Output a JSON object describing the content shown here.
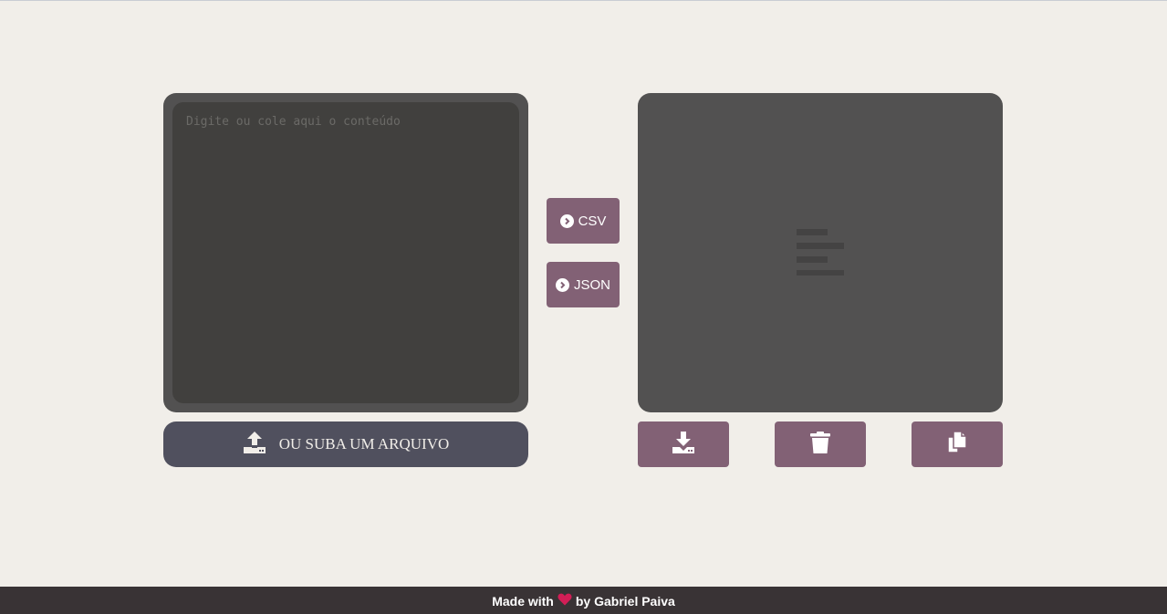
{
  "editor": {
    "placeholder": "Digite ou cole aqui o conteúdo",
    "value": ""
  },
  "upload": {
    "label": "OU SUBA UM ARQUIVO",
    "icon": "upload-icon"
  },
  "convert": {
    "csv_label": "CSV",
    "json_label": "JSON",
    "icon": "chevron-circle-right-icon"
  },
  "output": {
    "empty_icon": "align-left-icon"
  },
  "actions": {
    "download_icon": "download-icon",
    "clear_icon": "trash-icon",
    "copy_icon": "copy-icon"
  },
  "footer": {
    "made_with": "Made with",
    "by_text": "by Gabriel Paiva",
    "heart_icon": "heart-icon"
  },
  "colors": {
    "background": "#f1eee9",
    "panel": "#525151",
    "editor": "#41403e",
    "accent": "#826175",
    "upload": "#50505e",
    "footer": "#393335",
    "heart": "#d21e56"
  }
}
